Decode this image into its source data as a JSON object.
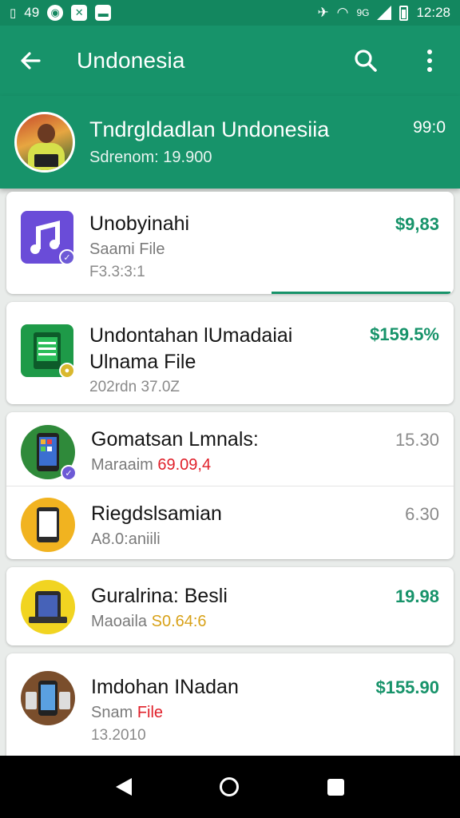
{
  "status_bar": {
    "left_text": "49",
    "left_icons": [
      "sim-icon",
      "whatsapp-icon",
      "close-box-icon",
      "message-icon"
    ],
    "network_label": "9G",
    "time": "12:28"
  },
  "app_bar": {
    "title": "Undonesia",
    "icons": [
      "back-arrow-icon",
      "search-icon",
      "more-vert-icon"
    ]
  },
  "header": {
    "title": "Tndrgldadlan Undonesiia",
    "subtitle": "Sdrenom: 19.900",
    "value": "99:0"
  },
  "items": [
    {
      "name": "Unobyinahi",
      "sub": "Saami File",
      "meta": "F3.3:3:1",
      "price": "$9,83",
      "icon": "music-app-icon"
    },
    {
      "name": "Undontahan lUmadaiai",
      "sub": "Ulnama File",
      "meta": "202rdn 37.0Z",
      "price": "$159.5%",
      "icon": "sheets-app-icon"
    },
    {
      "name": "Gomatsan Lmnals:",
      "sub_label": "Maraaim",
      "sub_value": "69.09,4",
      "price": "15.30",
      "icon": "phone-apps-icon"
    },
    {
      "name": "Riegdslsamian",
      "sub": "A8.0:aniili",
      "price": "6.30",
      "icon": "phone-yellow-icon"
    },
    {
      "name": "Guralrina: Besli",
      "sub_label": "Maoaila",
      "sub_value": "S0.64:6",
      "price": "19.98",
      "icon": "tablet-icon"
    },
    {
      "name": "Imdohan INadan",
      "sub_label": "Snam",
      "sub_value": "File",
      "meta": "13.2010",
      "price": "$155.90",
      "icon": "phone-stack-icon"
    }
  ],
  "nav_bar": {
    "icons": [
      "nav-back-icon",
      "nav-home-icon",
      "nav-recent-icon"
    ]
  },
  "colors": {
    "primary": "#17936a",
    "status_bar": "#13875f",
    "highlight_red": "#e0202a",
    "highlight_gold": "#d8a21a",
    "background": "#e9ecea"
  }
}
